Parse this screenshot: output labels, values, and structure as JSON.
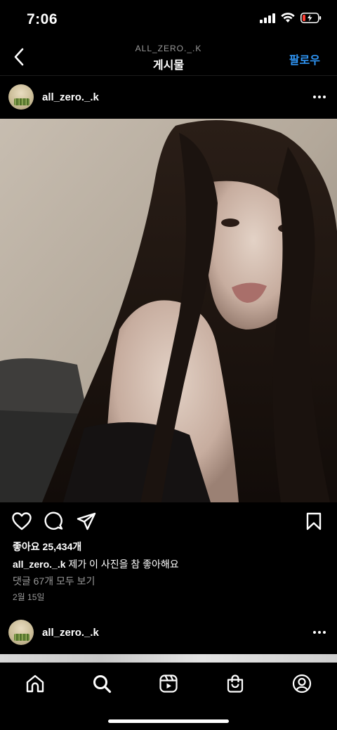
{
  "status_bar": {
    "time": "7:06"
  },
  "header": {
    "subtitle": "ALL_ZERO._.K",
    "title": "게시물",
    "follow_label": "팔로우"
  },
  "post": {
    "username": "all_zero._.k",
    "likes": "좋아요 25,434개",
    "caption_user": "all_zero._.k",
    "caption_text": "제가 이 사진을 참 좋아해요",
    "view_comments": "댓글 67개 모두 보기",
    "date": "2월 15일"
  },
  "next_post": {
    "username": "all_zero._.k"
  },
  "icons": {
    "back": "chevron-left-icon",
    "more": "more-horizontal-icon",
    "like": "heart-icon",
    "comment": "comment-icon",
    "share": "paper-plane-icon",
    "save": "bookmark-icon",
    "home": "home-icon",
    "search": "search-icon",
    "reels": "reels-icon",
    "shop": "shopping-bag-icon",
    "profile": "profile-icon"
  },
  "colors": {
    "background": "#000000",
    "accent_blue": "#2f95f5",
    "secondary_text": "#9a9a9a",
    "battery_low": "#ff3b30"
  }
}
